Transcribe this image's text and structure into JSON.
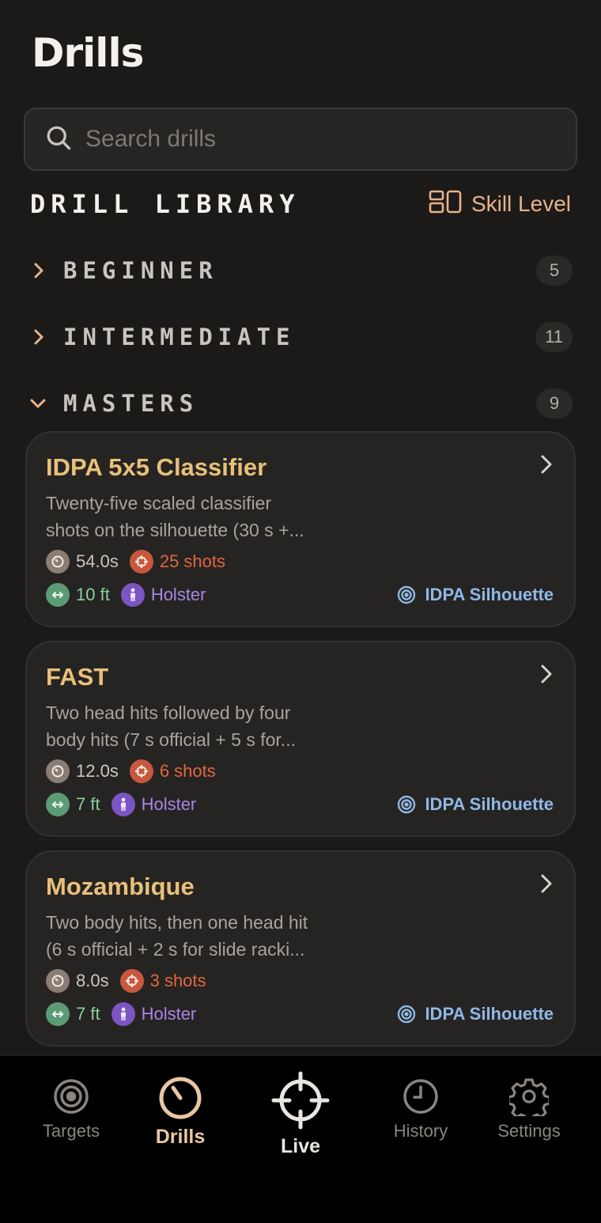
{
  "header": {
    "title": "Drills"
  },
  "search": {
    "placeholder": "Search drills"
  },
  "library": {
    "title": "DRILL LIBRARY",
    "skill_level_label": "Skill Level"
  },
  "sections": [
    {
      "label": "BEGINNER",
      "count": "5",
      "expanded": false
    },
    {
      "label": "INTERMEDIATE",
      "count": "11",
      "expanded": false
    },
    {
      "label": "MASTERS",
      "count": "9",
      "expanded": true
    }
  ],
  "drills": [
    {
      "title": "IDPA 5x5 Classifier",
      "desc_line1": "Twenty-five scaled classifier",
      "desc_line2": "shots on the silhouette (30 s +...",
      "time": "54.0s",
      "shots": "25 shots",
      "distance": "10 ft",
      "position": "Holster",
      "target": "IDPA Silhouette"
    },
    {
      "title": "FAST",
      "desc_line1": "Two head hits followed by four",
      "desc_line2": "body hits (7 s official + 5 s for...",
      "time": "12.0s",
      "shots": "6 shots",
      "distance": "7 ft",
      "position": "Holster",
      "target": "IDPA Silhouette"
    },
    {
      "title": "Mozambique",
      "desc_line1": "Two body hits, then one head hit",
      "desc_line2": "(6 s official + 2 s for slide racki...",
      "time": "8.0s",
      "shots": "3 shots",
      "distance": "7 ft",
      "position": "Holster",
      "target": "IDPA Silhouette"
    }
  ],
  "tabs": [
    {
      "label": "Targets",
      "icon": "target-icon"
    },
    {
      "label": "Drills",
      "icon": "timer-icon",
      "active": true
    },
    {
      "label": "Live",
      "icon": "crosshair-icon"
    },
    {
      "label": "History",
      "icon": "clock-icon"
    },
    {
      "label": "Settings",
      "icon": "gear-icon"
    }
  ],
  "colors": {
    "accent": "#e6b288",
    "card_title": "#e7c07a",
    "shots": "#e0673f",
    "distance": "#86d19b",
    "position": "#a586e6",
    "target": "#8fb8e6"
  }
}
